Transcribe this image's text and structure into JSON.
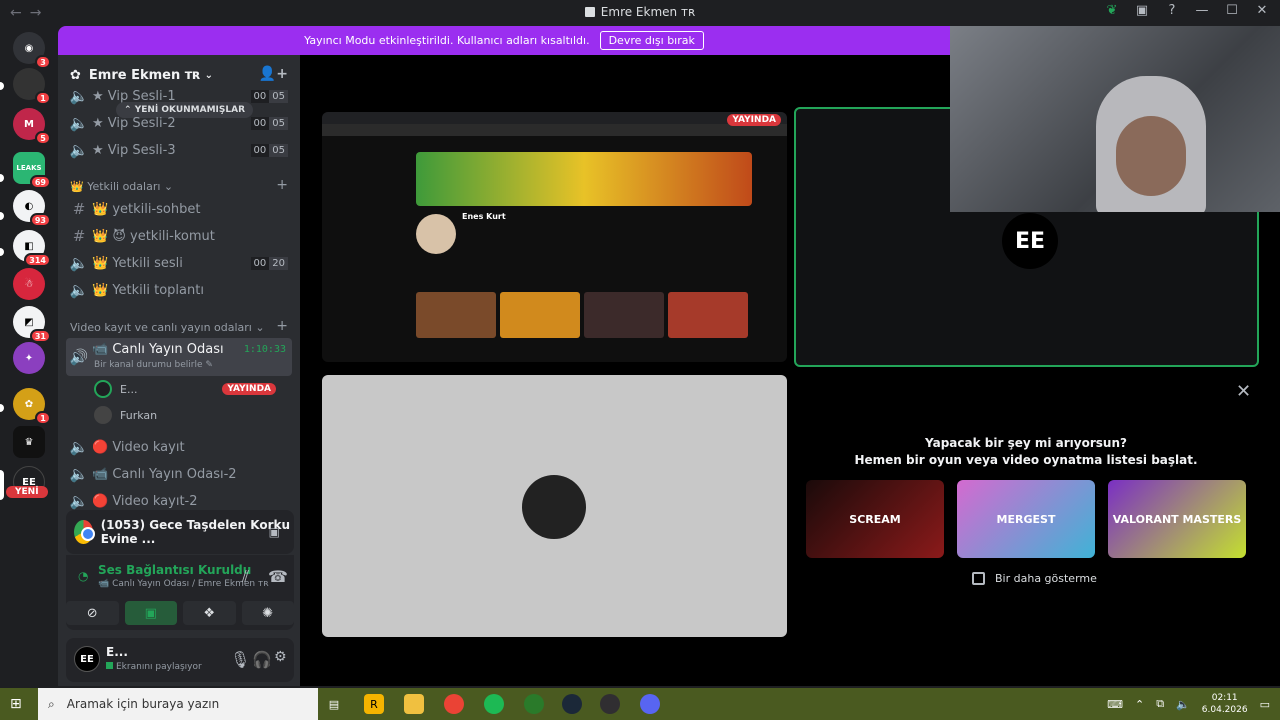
{
  "window": {
    "title": "Emre Ekmen ᴛʀ"
  },
  "banner": {
    "text": "Yayıncı Modu etkinleştirildi. Kullanıcı adları kısaltıldı.",
    "button": "Devre dışı bırak"
  },
  "rail": {
    "servers": [
      {
        "label": "",
        "badge": "3",
        "color": "#5865f2"
      },
      {
        "label": "",
        "badge": "1",
        "color": "#333"
      },
      {
        "label": "M",
        "badge": "5",
        "color": "#c0264a"
      },
      {
        "label": "LEAKS",
        "badge": "69",
        "color": "#2bb673"
      },
      {
        "label": "",
        "badge": "93",
        "color": "#f2f3f5"
      },
      {
        "label": "",
        "badge": "314",
        "color": "#f2f3f5"
      },
      {
        "label": "",
        "badge": "",
        "color": "#d7263d"
      },
      {
        "label": "",
        "badge": "31",
        "color": "#f2f3f5"
      },
      {
        "label": "",
        "badge": "",
        "color": "#8b3fbf"
      },
      {
        "label": "",
        "badge": "1",
        "color": "#d4a017"
      },
      {
        "label": "",
        "badge": "",
        "color": "#111"
      },
      {
        "label": "EE",
        "badge": "",
        "color": "#1e1f22"
      }
    ],
    "new_label": "YENİ"
  },
  "sidebar": {
    "server_name": "Emre Ekmen ᴛʀ",
    "unread_pill": "YENİ OKUNMAMIŞLAR",
    "vip_channels": [
      {
        "name": "★ Vip Sesli-1",
        "lim": [
          "00",
          "05"
        ]
      },
      {
        "name": "★ Vip Sesli-2",
        "lim": [
          "00",
          "05"
        ]
      },
      {
        "name": "★ Vip Sesli-3",
        "lim": [
          "00",
          "05"
        ]
      }
    ],
    "cat_staff": "👑 Yetkili odaları",
    "staff_channels": [
      {
        "name": "👑 yetkili-sohbet",
        "type": "text"
      },
      {
        "name": "👑 😈 yetkili-komut",
        "type": "text"
      },
      {
        "name": "👑 Yetkili sesli",
        "type": "voice",
        "lim": [
          "00",
          "20"
        ]
      },
      {
        "name": "👑 Yetkili toplantı",
        "type": "voice"
      }
    ],
    "cat_video": "Video kayıt ve canlı yayın odaları",
    "live_channel": {
      "name": "📹 Canlı Yayın Odası",
      "time": "1:10:33",
      "status": "Bir kanal durumu belirle"
    },
    "members": [
      {
        "name": "E...",
        "live": "YAYINDA"
      },
      {
        "name": "Furkan",
        "live": ""
      }
    ],
    "more_channels": [
      "🔴 Video kayıt",
      "📹 Canlı Yayın Odası-2",
      "🔴 Video kayıt-2"
    ]
  },
  "activity": {
    "title": "(1053) Gece Taşdelen Korku Evine ..."
  },
  "voice": {
    "status": "Ses Bağlantısı Kuruldu",
    "location": "📹 Canlı Yayın Odası / Emre Ekmen ᴛʀ"
  },
  "user": {
    "name": "E...",
    "status": "Ekranını paylaşıyor"
  },
  "main": {
    "yt_live": "YAYINDA",
    "yt_channel": "Enes Kurt",
    "cam_initials": "EE",
    "promo_title_1": "Yapacak bir şey mi arıyorsun?",
    "promo_title_2": "Hemen bir oyun veya video oynatma listesi başlat.",
    "games": [
      "SCREAM",
      "MERGEST",
      "VALORANT MASTERS"
    ],
    "dont_show": "Bir daha gösterme"
  },
  "taskbar": {
    "search": "Aramak için buraya yazın",
    "time": "02:11",
    "date": "6.04.2026"
  }
}
